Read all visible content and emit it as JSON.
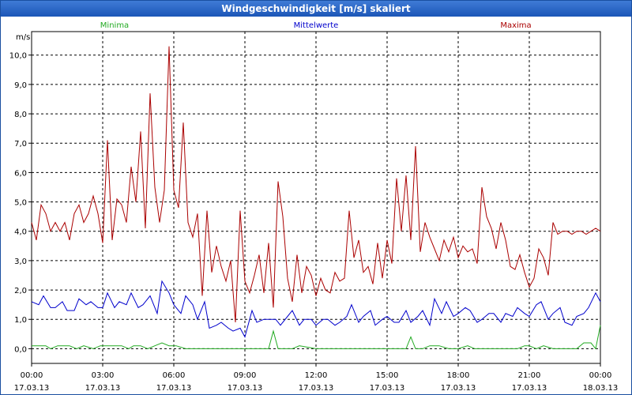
{
  "window": {
    "title": "Windgeschwindigkeit [m/s] skaliert"
  },
  "chart_data": {
    "type": "line",
    "ylabel": "m/s",
    "ylim": [
      -0.5,
      10.8
    ],
    "xlim_hours": [
      0,
      24
    ],
    "yticks": [
      "0,0",
      "1,0",
      "2,0",
      "3,0",
      "4,0",
      "5,0",
      "6,0",
      "7,0",
      "8,0",
      "9,0",
      "10,0"
    ],
    "ytick_values": [
      0,
      1,
      2,
      3,
      4,
      5,
      6,
      7,
      8,
      9,
      10
    ],
    "xticks": [
      {
        "time": "00:00",
        "date": "17.03.13"
      },
      {
        "time": "03:00",
        "date": "17.03.13"
      },
      {
        "time": "06:00",
        "date": "17.03.13"
      },
      {
        "time": "09:00",
        "date": "17.03.13"
      },
      {
        "time": "12:00",
        "date": "17.03.13"
      },
      {
        "time": "15:00",
        "date": "17.03.13"
      },
      {
        "time": "18:00",
        "date": "17.03.13"
      },
      {
        "time": "21:00",
        "date": "17.03.13"
      },
      {
        "time": "00:00",
        "date": "18.03.13"
      }
    ],
    "grid": true,
    "series": [
      {
        "name": "Minima",
        "color": "#22aa22",
        "x_hours": [
          0,
          0.6,
          0.8,
          1.1,
          1.3,
          1.6,
          1.9,
          2.2,
          2.6,
          2.9,
          3.1,
          3.5,
          3.8,
          4.1,
          4.3,
          4.6,
          4.9,
          5.2,
          5.5,
          5.8,
          6.1,
          6.5,
          7.5,
          8.5,
          9.5,
          10,
          10.2,
          10.4,
          10.7,
          11,
          11.3,
          12,
          13,
          14,
          15,
          15.8,
          16,
          16.2,
          16.5,
          16.8,
          17.2,
          17.6,
          18,
          18.4,
          18.7,
          19,
          19.5,
          20,
          20.5,
          20.8,
          21,
          21.3,
          21.6,
          22,
          22.5,
          23,
          23.3,
          23.6,
          23.8,
          24
        ],
        "values": [
          0.1,
          0.1,
          0,
          0.1,
          0.1,
          0.1,
          0,
          0.1,
          0,
          0.1,
          0.1,
          0.1,
          0.1,
          0,
          0.1,
          0.1,
          0,
          0.1,
          0.2,
          0.1,
          0.1,
          0,
          0,
          0,
          0,
          0,
          0.6,
          0,
          0,
          0,
          0.1,
          0,
          0,
          0,
          0,
          0,
          0.4,
          0,
          0,
          0.1,
          0.1,
          0,
          0,
          0.1,
          0,
          0,
          0,
          0,
          0,
          0.1,
          0.1,
          0,
          0.1,
          0,
          0,
          0,
          0.2,
          0.2,
          0,
          0.8
        ]
      },
      {
        "name": "Mittelwerte",
        "color": "#0000cc",
        "x_hours": [
          0,
          0.3,
          0.5,
          0.8,
          1,
          1.3,
          1.5,
          1.8,
          2,
          2.3,
          2.5,
          2.8,
          3,
          3.2,
          3.5,
          3.7,
          4,
          4.2,
          4.5,
          4.7,
          5,
          5.3,
          5.5,
          5.8,
          6,
          6.3,
          6.5,
          6.8,
          7,
          7.3,
          7.5,
          7.8,
          8,
          8.3,
          8.5,
          8.8,
          9,
          9.3,
          9.5,
          9.8,
          10,
          10.3,
          10.5,
          10.8,
          11,
          11.3,
          11.5,
          11.8,
          12,
          12.3,
          12.5,
          12.8,
          13,
          13.3,
          13.5,
          13.8,
          14,
          14.3,
          14.5,
          14.8,
          15,
          15.3,
          15.5,
          15.8,
          16,
          16.3,
          16.5,
          16.8,
          17,
          17.3,
          17.5,
          17.8,
          18,
          18.3,
          18.5,
          18.8,
          19,
          19.3,
          19.5,
          19.8,
          20,
          20.3,
          20.5,
          20.8,
          21,
          21.3,
          21.5,
          21.8,
          22,
          22.3,
          22.5,
          22.8,
          23,
          23.3,
          23.5,
          23.8,
          24
        ],
        "values": [
          1.6,
          1.5,
          1.8,
          1.4,
          1.4,
          1.6,
          1.3,
          1.3,
          1.7,
          1.5,
          1.6,
          1.4,
          1.4,
          1.9,
          1.4,
          1.6,
          1.5,
          1.9,
          1.4,
          1.5,
          1.8,
          1.2,
          2.3,
          1.9,
          1.5,
          1.2,
          1.8,
          1.5,
          1.0,
          1.6,
          0.7,
          0.8,
          0.9,
          0.7,
          0.6,
          0.7,
          0.4,
          1.3,
          0.9,
          1.0,
          1.0,
          1.0,
          0.8,
          1.1,
          1.3,
          0.8,
          1.0,
          1.0,
          0.8,
          1.0,
          1.0,
          0.8,
          0.9,
          1.1,
          1.5,
          0.9,
          1.1,
          1.3,
          0.8,
          1.0,
          1.1,
          0.9,
          0.9,
          1.3,
          0.9,
          1.1,
          1.3,
          0.8,
          1.7,
          1.2,
          1.6,
          1.1,
          1.2,
          1.4,
          1.3,
          0.9,
          1.0,
          1.2,
          1.2,
          0.9,
          1.2,
          1.1,
          1.4,
          1.2,
          1.1,
          1.5,
          1.6,
          1.0,
          1.2,
          1.4,
          0.9,
          0.8,
          1.1,
          1.2,
          1.4,
          1.9,
          1.6,
          2.3
        ]
      },
      {
        "name": "Maxima",
        "color": "#aa0000",
        "x_hours": [
          0,
          0.2,
          0.4,
          0.6,
          0.8,
          1,
          1.2,
          1.4,
          1.6,
          1.8,
          2,
          2.2,
          2.4,
          2.6,
          2.8,
          3,
          3.2,
          3.4,
          3.6,
          3.8,
          4,
          4.2,
          4.4,
          4.6,
          4.8,
          5,
          5.2,
          5.4,
          5.6,
          5.8,
          6,
          6.2,
          6.4,
          6.6,
          6.8,
          7,
          7.2,
          7.4,
          7.6,
          7.8,
          8,
          8.2,
          8.4,
          8.6,
          8.8,
          9,
          9.2,
          9.4,
          9.6,
          9.8,
          10,
          10.2,
          10.4,
          10.6,
          10.8,
          11,
          11.2,
          11.4,
          11.6,
          11.8,
          12,
          12.2,
          12.4,
          12.6,
          12.8,
          13,
          13.2,
          13.4,
          13.6,
          13.8,
          14,
          14.2,
          14.4,
          14.6,
          14.8,
          15,
          15.2,
          15.4,
          15.6,
          15.8,
          16,
          16.2,
          16.4,
          16.6,
          16.8,
          17,
          17.2,
          17.4,
          17.6,
          17.8,
          18,
          18.2,
          18.4,
          18.6,
          18.8,
          19,
          19.2,
          19.4,
          19.6,
          19.8,
          20,
          20.2,
          20.4,
          20.6,
          20.8,
          21,
          21.2,
          21.4,
          21.6,
          21.8,
          22,
          22.2,
          22.4,
          22.6,
          22.8,
          23,
          23.2,
          23.4,
          23.6,
          23.8,
          24
        ],
        "values": [
          4.3,
          3.7,
          4.9,
          4.6,
          4.0,
          4.3,
          4.0,
          4.3,
          3.7,
          4.6,
          4.9,
          4.3,
          4.6,
          5.2,
          4.6,
          3.6,
          7.1,
          3.7,
          5.1,
          4.9,
          4.3,
          6.2,
          5.0,
          7.4,
          4.1,
          8.7,
          5.5,
          4.3,
          5.4,
          10.3,
          5.4,
          4.8,
          7.7,
          4.3,
          3.8,
          4.6,
          1.8,
          4.7,
          2.6,
          3.5,
          2.8,
          2.3,
          3.0,
          0.9,
          4.7,
          2.3,
          1.9,
          2.5,
          3.2,
          1.9,
          3.6,
          1.4,
          5.7,
          4.5,
          2.4,
          1.6,
          3.2,
          1.9,
          2.8,
          2.5,
          1.8,
          2.4,
          2.0,
          1.9,
          2.6,
          2.3,
          2.4,
          4.7,
          3.1,
          3.7,
          2.6,
          2.8,
          2.2,
          3.6,
          2.4,
          3.7,
          2.9,
          5.8,
          4.0,
          5.9,
          3.7,
          6.9,
          3.3,
          4.3,
          3.8,
          3.4,
          3.0,
          3.7,
          3.3,
          3.8,
          3.1,
          3.5,
          3.3,
          3.4,
          2.9,
          5.5,
          4.5,
          4.1,
          3.4,
          4.3,
          3.7,
          2.8,
          2.7,
          3.2,
          2.6,
          2.1,
          2.4,
          3.4,
          3.1,
          2.5,
          4.3,
          3.9,
          4.0,
          4.0,
          3.9,
          4.0,
          4.0,
          3.9,
          4.0,
          4.1,
          4.0,
          4.0
        ]
      }
    ]
  }
}
